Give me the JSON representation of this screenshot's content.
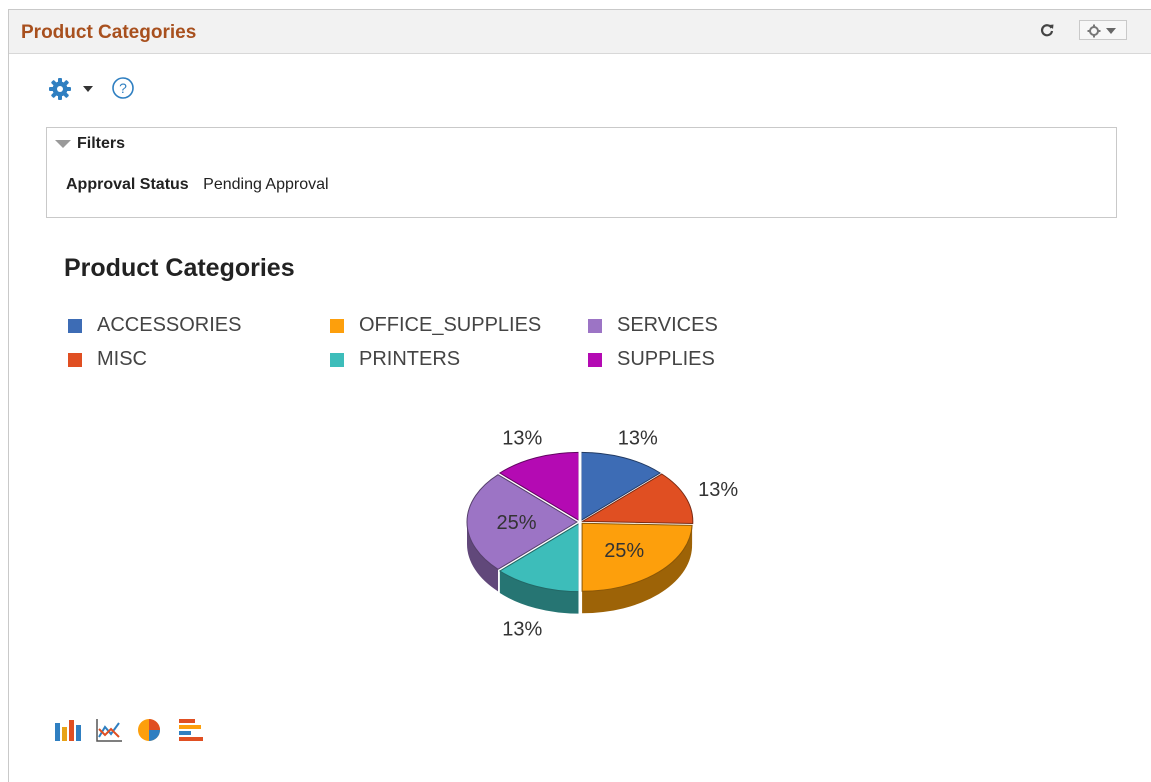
{
  "header": {
    "title": "Product Categories",
    "refresh_icon": "refresh-icon",
    "settings_icon": "gear-icon"
  },
  "toolbar": {
    "settings_icon": "gear-icon",
    "help_icon": "help-icon",
    "help_glyph": "?"
  },
  "filters": {
    "label": "Filters",
    "items": [
      {
        "key": "Approval Status",
        "value": "Pending Approval"
      }
    ]
  },
  "chart_data": {
    "type": "pie",
    "title": "Product Categories",
    "legend_position": "top-left",
    "series": [
      {
        "name": "ACCESSORIES",
        "value": 13,
        "label": "13%",
        "color": "#3d6cb5"
      },
      {
        "name": "MISC",
        "value": 13,
        "label": "13%",
        "color": "#e04f22"
      },
      {
        "name": "OFFICE_SUPPLIES",
        "value": 25,
        "label": "25%",
        "color": "#fd9f0c"
      },
      {
        "name": "PRINTERS",
        "value": 13,
        "label": "13%",
        "color": "#3dbdba"
      },
      {
        "name": "SERVICES",
        "value": 25,
        "label": "25%",
        "color": "#9c74c5"
      },
      {
        "name": "SUPPLIES",
        "value": 13,
        "label": "13%",
        "color": "#b40ab3"
      }
    ]
  },
  "chart_types": [
    "bar-chart-icon",
    "line-chart-icon",
    "pie-chart-icon",
    "horizontal-bar-chart-icon"
  ]
}
